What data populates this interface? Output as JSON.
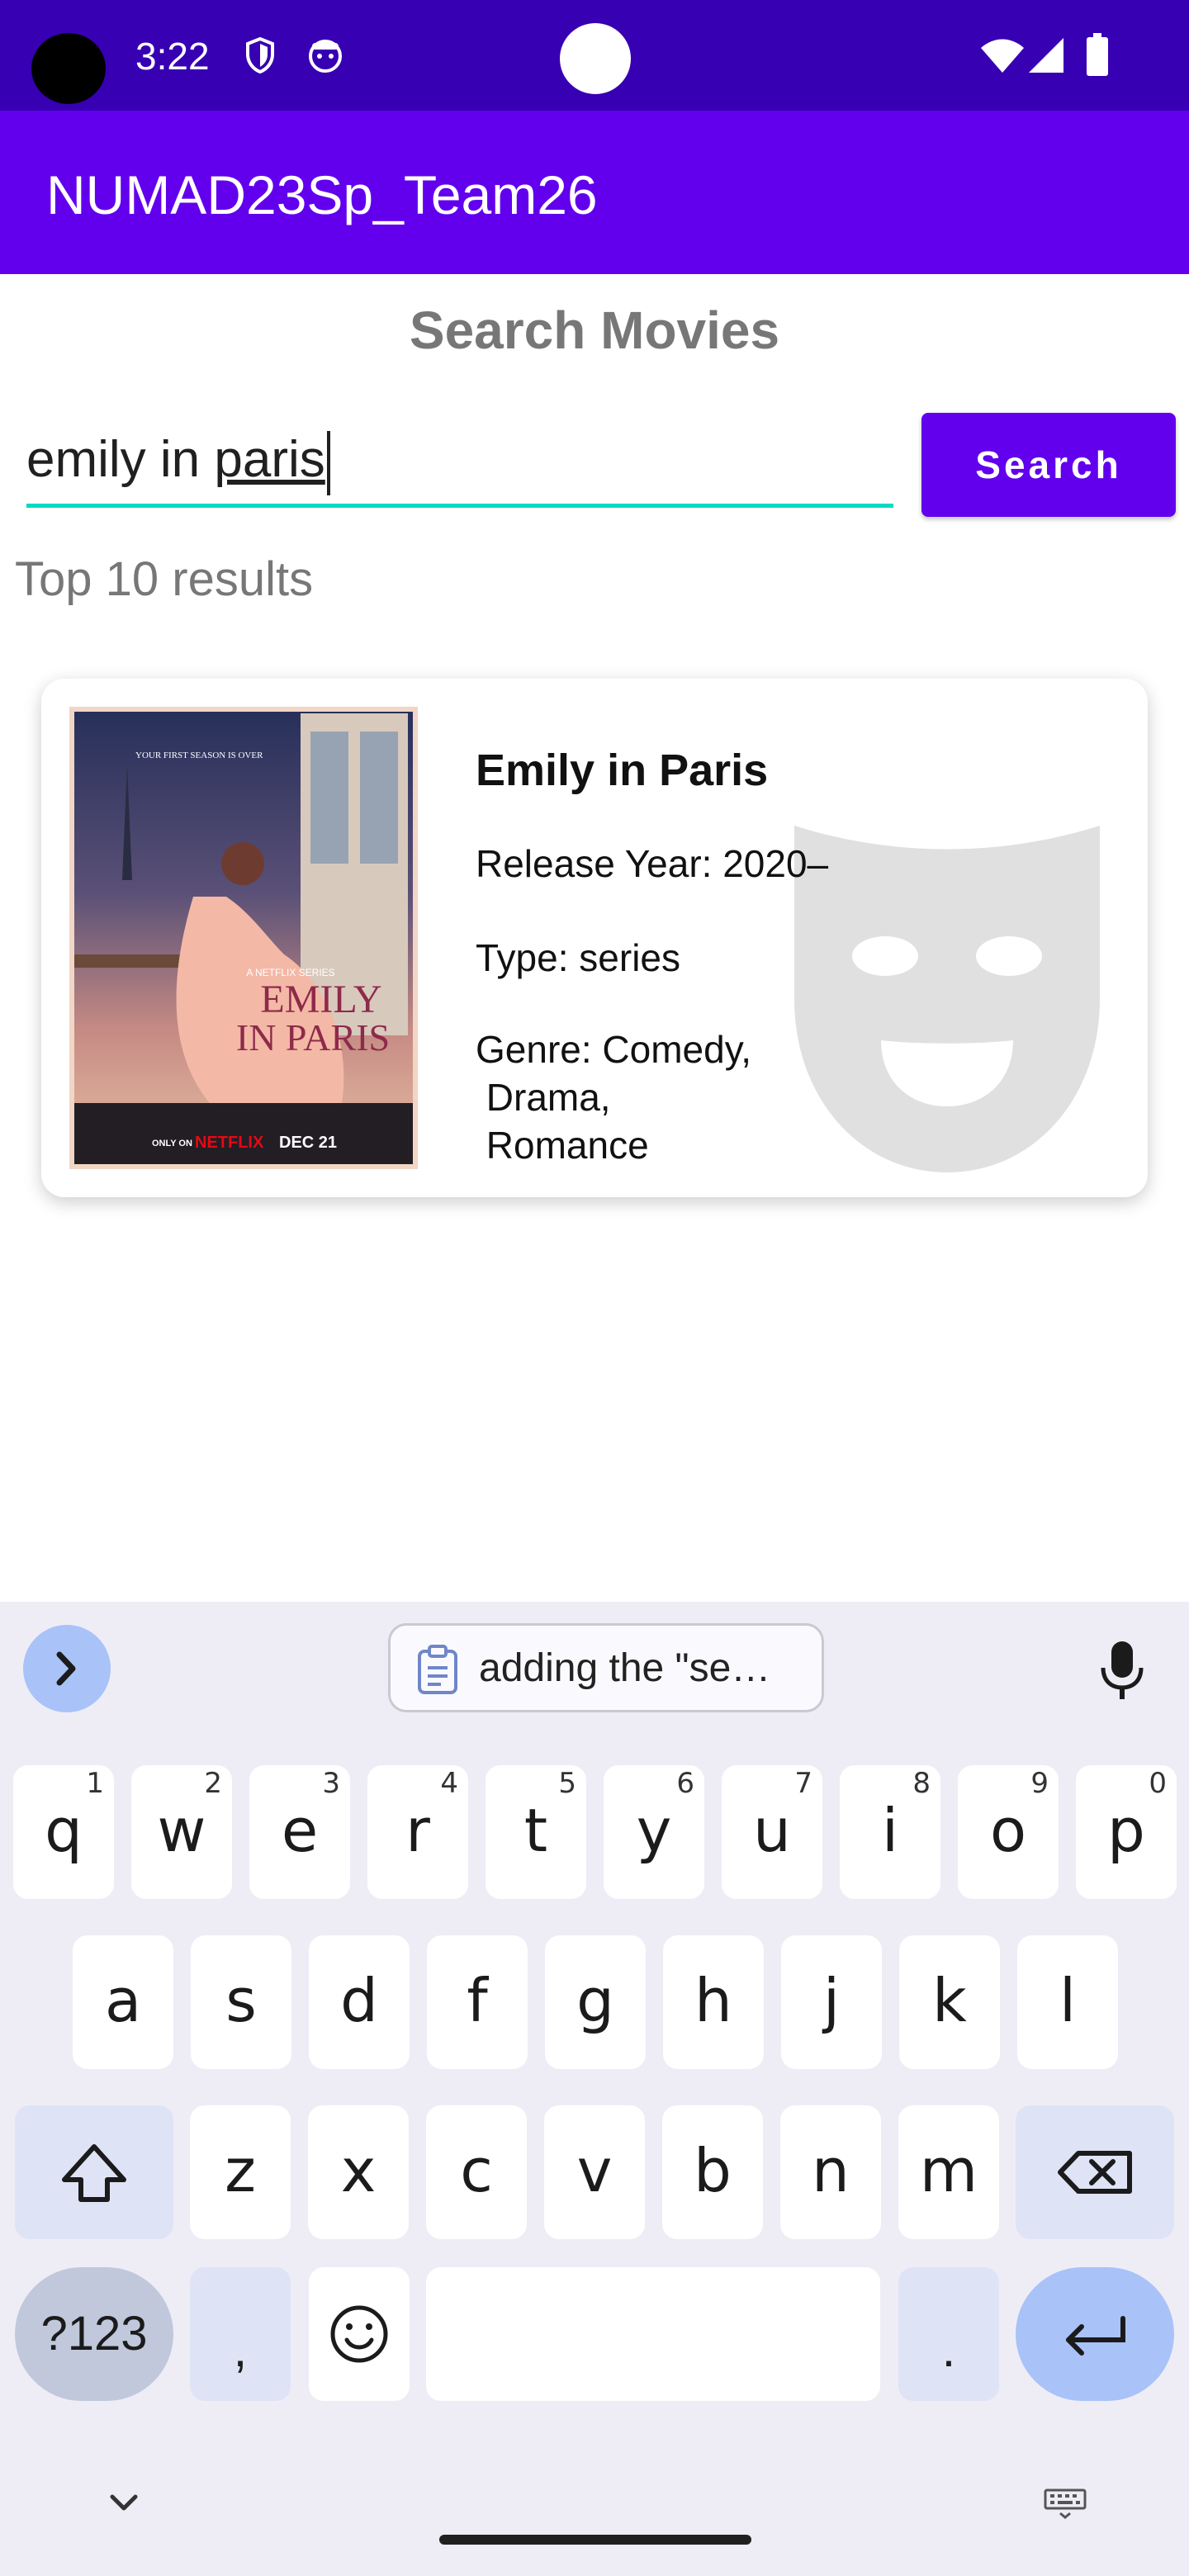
{
  "status_bar": {
    "time": "3:22"
  },
  "app_bar": {
    "title": "NUMAD23Sp_Team26"
  },
  "page": {
    "heading": "Search Movies"
  },
  "search": {
    "value_prefix": "emily in ",
    "value_underlined": "paris",
    "button_label": "Search"
  },
  "results": {
    "label": "Top 10 results",
    "items": [
      {
        "title": "Emily in Paris",
        "year": "Release Year: 2020–",
        "type": "Type: series",
        "genre": "Genre: Comedy,\n Drama,\n Romance",
        "poster": {
          "tagline": "YOUR FIRST SEASON IS OVER",
          "series_label": "A NETFLIX SERIES",
          "title_line1": "EMILY",
          "title_line2": "IN PARIS",
          "footer_only": "ONLY ON",
          "footer_brand": "NETFLIX",
          "footer_date": "DEC 21"
        }
      }
    ]
  },
  "keyboard": {
    "clipboard_suggestion": "adding the \"se…",
    "row1": [
      {
        "k": "q",
        "h": "1"
      },
      {
        "k": "w",
        "h": "2"
      },
      {
        "k": "e",
        "h": "3"
      },
      {
        "k": "r",
        "h": "4"
      },
      {
        "k": "t",
        "h": "5"
      },
      {
        "k": "y",
        "h": "6"
      },
      {
        "k": "u",
        "h": "7"
      },
      {
        "k": "i",
        "h": "8"
      },
      {
        "k": "o",
        "h": "9"
      },
      {
        "k": "p",
        "h": "0"
      }
    ],
    "row2": [
      "a",
      "s",
      "d",
      "f",
      "g",
      "h",
      "j",
      "k",
      "l"
    ],
    "row3": [
      "z",
      "x",
      "c",
      "v",
      "b",
      "n",
      "m"
    ],
    "symbols_label": "?123",
    "comma_label": ",",
    "period_label": "."
  },
  "colors": {
    "status_bar": "#3700b3",
    "app_bar": "#6200ee",
    "accent": "#03dac5",
    "keyboard_bg": "#eeedf6",
    "enter_key": "#a9c2f8"
  }
}
